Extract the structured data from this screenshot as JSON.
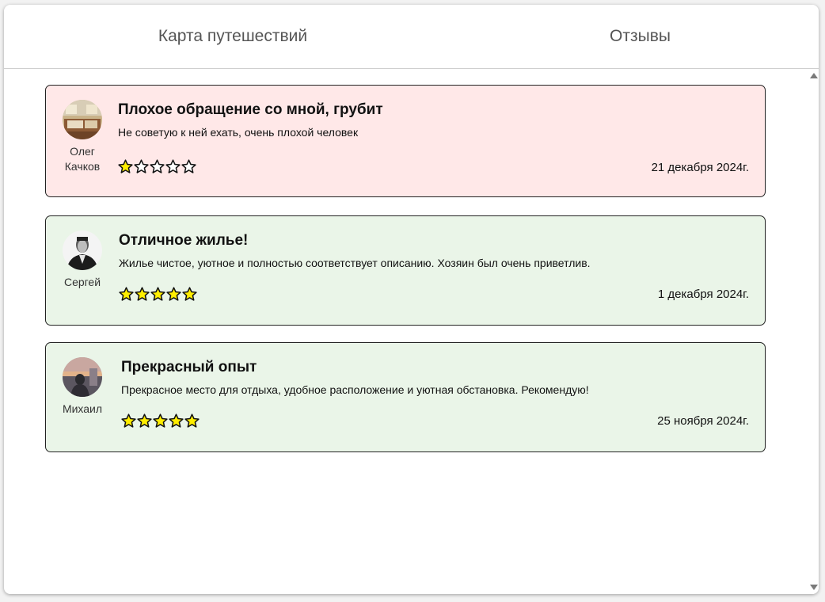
{
  "tabs": [
    {
      "label": "Карта путешествий"
    },
    {
      "label": "Отзывы"
    }
  ],
  "reviews": [
    {
      "author": "Олег Качков",
      "title": "Плохое обращение со мной, грубит",
      "text": "Не советую к ней ехать, очень плохой человек",
      "rating": 1,
      "date": "21 декабря 2024г.",
      "sentiment": "negative",
      "background": "#ffe8e8"
    },
    {
      "author": "Сергей",
      "title": "Отличное жилье!",
      "text": "Жилье чистое, уютное и полностью соответствует описанию. Хозяин был очень приветлив.",
      "rating": 5,
      "date": "1 декабря 2024г.",
      "sentiment": "positive",
      "background": "#eaf5e8"
    },
    {
      "author": "Михаил",
      "title": "Прекрасный опыт",
      "text": "Прекрасное место для отдыха, удобное расположение и уютная обстановка. Рекомендую!",
      "rating": 5,
      "date": "25 ноября 2024г.",
      "sentiment": "positive",
      "background": "#eaf5e8"
    }
  ],
  "colors": {
    "star_filled": "#ffee00",
    "star_empty": "#ffffff",
    "star_outline": "#111111"
  }
}
